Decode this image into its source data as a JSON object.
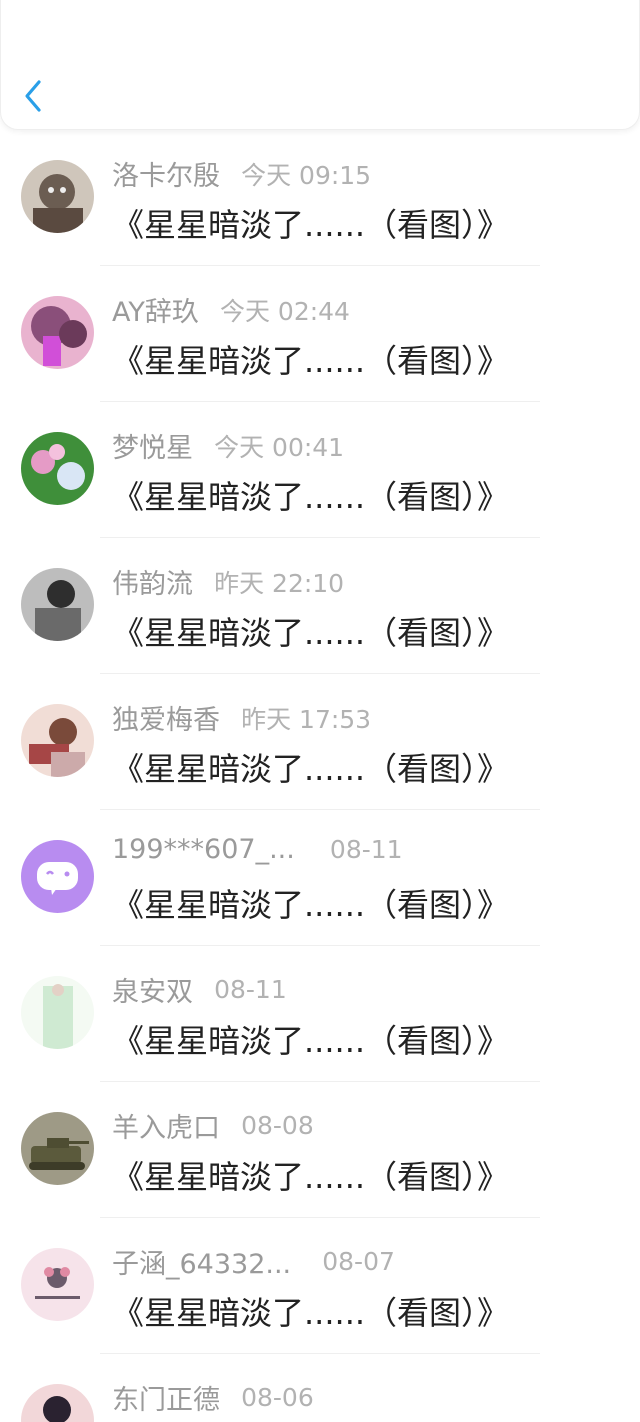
{
  "header": {
    "back_icon": "chevron-left-icon",
    "accent_color": "#2a9fe8"
  },
  "comments": [
    {
      "name": "洛卡尔殷",
      "time": "今天 09:15",
      "content": "《星星暗淡了......（看图）》",
      "avatar_colors": [
        "#6b5d52",
        "#cfc6bb"
      ]
    },
    {
      "name": "AY辞玖",
      "time": "今天 02:44",
      "content": "《星星暗淡了......（看图）》",
      "avatar_colors": [
        "#8a4f7a",
        "#e9b3cf"
      ]
    },
    {
      "name": "梦悦星",
      "time": "今天 00:41",
      "content": "《星星暗淡了......（看图）》",
      "avatar_colors": [
        "#3f8f3a",
        "#e59bc6"
      ]
    },
    {
      "name": "伟韵流",
      "time": "昨天 22:10",
      "content": "《星星暗淡了......（看图）》",
      "avatar_colors": [
        "#4a4a4a",
        "#bdbdbd"
      ]
    },
    {
      "name": "独爱梅香",
      "time": "昨天 17:53",
      "content": "《星星暗淡了......（看图）》",
      "avatar_colors": [
        "#8a3b3b",
        "#f1ddd6"
      ]
    },
    {
      "name": "199***607_...",
      "time": "08-11",
      "content": "《星星暗淡了......（看图）》",
      "avatar_colors": [
        "#b88cf0",
        "#ffffff"
      ]
    },
    {
      "name": "泉安双",
      "time": "08-11",
      "content": "《星星暗淡了......（看图）》",
      "avatar_colors": [
        "#cfead2",
        "#f4faf3"
      ]
    },
    {
      "name": "羊入虎口",
      "time": "08-08",
      "content": "《星星暗淡了......（看图）》",
      "avatar_colors": [
        "#5b5a3c",
        "#9e9a86"
      ]
    },
    {
      "name": "子涵_64332...",
      "time": "08-07",
      "content": "《星星暗淡了......（看图）》",
      "avatar_colors": [
        "#f6e3ea",
        "#6b5b6b"
      ]
    },
    {
      "name": "东门正德",
      "time": "08-06",
      "content": "",
      "avatar_colors": [
        "#b4445a",
        "#f2d7d9"
      ]
    }
  ]
}
